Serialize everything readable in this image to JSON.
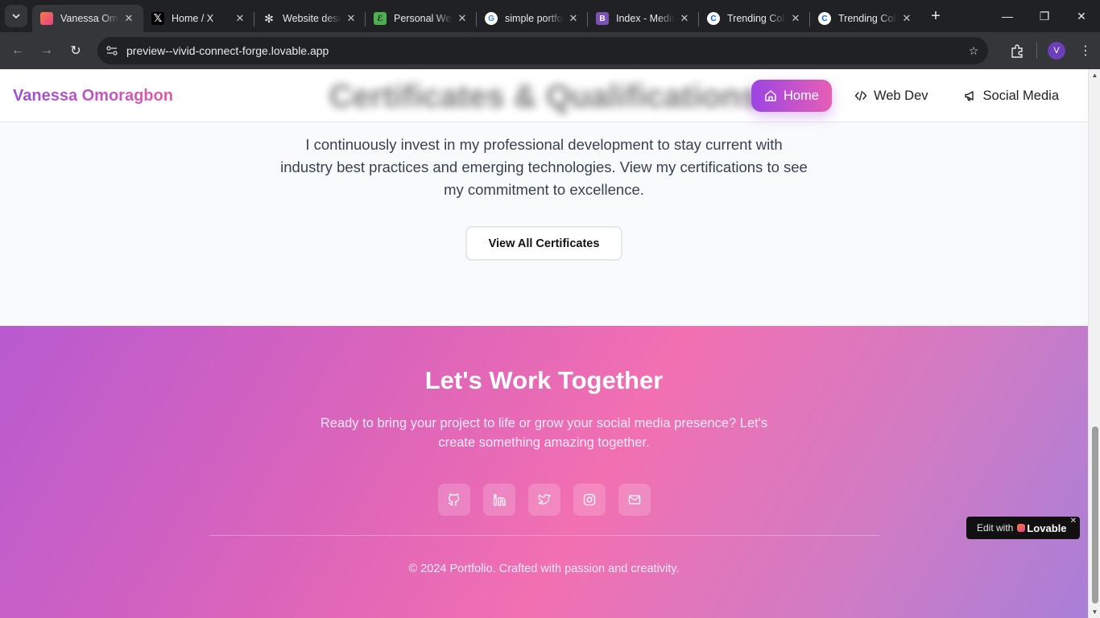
{
  "browser": {
    "tabs": [
      {
        "title": "Vanessa Omoragbon",
        "icon": "lovable-heart-icon",
        "color": "#e0428c",
        "active": true
      },
      {
        "title": "Home / X",
        "icon": "x-logo-icon",
        "color": "#000000",
        "active": false
      },
      {
        "title": "Website design",
        "icon": "openai-icon",
        "color": "#ffffff",
        "active": false
      },
      {
        "title": "Personal Website",
        "icon": "notion-green-icon",
        "color": "#4caf50",
        "active": false
      },
      {
        "title": "simple portfolio",
        "icon": "google-icon",
        "color": "#4285f4",
        "active": false
      },
      {
        "title": "Index - Medium",
        "icon": "bootstrap-icon",
        "color": "#7952b3",
        "active": false
      },
      {
        "title": "Trending Colors",
        "icon": "coolors-icon",
        "color": "#0066ff",
        "active": false
      },
      {
        "title": "Trending Colors",
        "icon": "coolors-icon",
        "color": "#0066ff",
        "active": false
      }
    ],
    "url": "preview--vivid-connect-forge.lovable.app",
    "profile_initial": "V"
  },
  "site": {
    "brand": "Vanessa Omoragbon",
    "section_title": "Certificates & Qualifications",
    "nav": [
      {
        "label": "Home",
        "icon": "home-icon",
        "active": true
      },
      {
        "label": "Web Dev",
        "icon": "code-icon",
        "active": false
      },
      {
        "label": "Social Media",
        "icon": "megaphone-icon",
        "active": false
      }
    ],
    "intro": "I continuously invest in my professional development to stay current with industry best practices and emerging technologies. View my certifications to see my commitment to excellence.",
    "cert_button": "View All Certificates",
    "footer": {
      "title": "Let's Work Together",
      "text": "Ready to bring your project to life or grow your social media presence? Let's create something amazing together.",
      "socials": [
        "github-icon",
        "linkedin-icon",
        "twitter-icon",
        "instagram-icon",
        "mail-icon"
      ],
      "copyright": "© 2024 Portfolio. Crafted with passion and creativity."
    },
    "lovable_badge": {
      "prefix": "Edit with",
      "brand": "Lovable"
    }
  }
}
